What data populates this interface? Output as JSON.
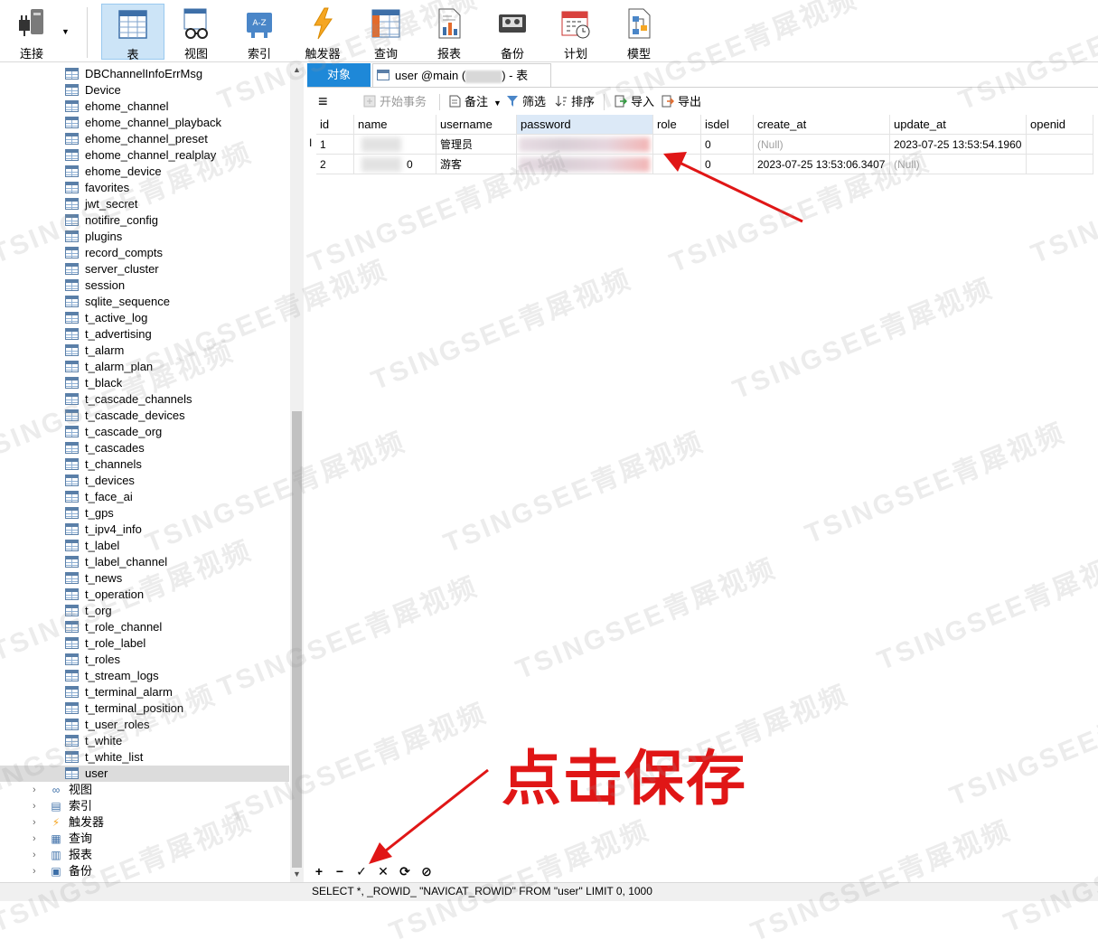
{
  "toolbar": {
    "connect": "连接",
    "table": "表",
    "view": "视图",
    "index": "索引",
    "trigger": "触发器",
    "query": "查询",
    "report": "报表",
    "backup": "备份",
    "schedule": "计划",
    "model": "模型"
  },
  "tree": {
    "tables": [
      "DBChannelInfoErrMsg",
      "Device",
      "ehome_channel",
      "ehome_channel_playback",
      "ehome_channel_preset",
      "ehome_channel_realplay",
      "ehome_device",
      "favorites",
      "jwt_secret",
      "notifire_config",
      "plugins",
      "record_compts",
      "server_cluster",
      "session",
      "sqlite_sequence",
      "t_active_log",
      "t_advertising",
      "t_alarm",
      "t_alarm_plan",
      "t_black",
      "t_cascade_channels",
      "t_cascade_devices",
      "t_cascade_org",
      "t_cascades",
      "t_channels",
      "t_devices",
      "t_face_ai",
      "t_gps",
      "t_ipv4_info",
      "t_label",
      "t_label_channel",
      "t_news",
      "t_operation",
      "t_org",
      "t_role_channel",
      "t_role_label",
      "t_roles",
      "t_stream_logs",
      "t_terminal_alarm",
      "t_terminal_position",
      "t_user_roles",
      "t_white",
      "t_white_list",
      "user"
    ],
    "groups": [
      "视图",
      "索引",
      "触发器",
      "查询",
      "报表",
      "备份"
    ]
  },
  "tabs": {
    "objects": "对象",
    "user_prefix": "user @main (",
    "user_suffix": ") - 表"
  },
  "gridbar": {
    "begin_transaction": "开始事务",
    "memo": "备注",
    "filter": "筛选",
    "sort": "排序",
    "import": "导入",
    "export": "导出"
  },
  "grid": {
    "columns": [
      "id",
      "name",
      "username",
      "password",
      "role",
      "isdel",
      "create_at",
      "update_at",
      "openid"
    ],
    "rows": [
      {
        "id": "1",
        "name": "",
        "username": "管理员",
        "password": "",
        "role": "",
        "isdel": "0",
        "create_at": "(Null)",
        "update_at": "2023-07-25 13:53:54.1960",
        "openid": ""
      },
      {
        "id": "2",
        "name": "0",
        "username": "游客",
        "password": "",
        "role": "",
        "isdel": "0",
        "create_at": "2023-07-25 13:53:06.3407",
        "update_at": "(Null)",
        "openid": ""
      }
    ]
  },
  "status": {
    "sql": "SELECT *, _ROWID_ \"NAVICAT_ROWID\" FROM \"user\" LIMIT 0, 1000"
  },
  "annotation": {
    "text": "点击保存"
  },
  "watermark": "TSINGSEE青犀视频",
  "colors": {
    "accent": "#1e88d8",
    "annotation_red": "#e01616",
    "selected_row": "#dcdcdc"
  }
}
